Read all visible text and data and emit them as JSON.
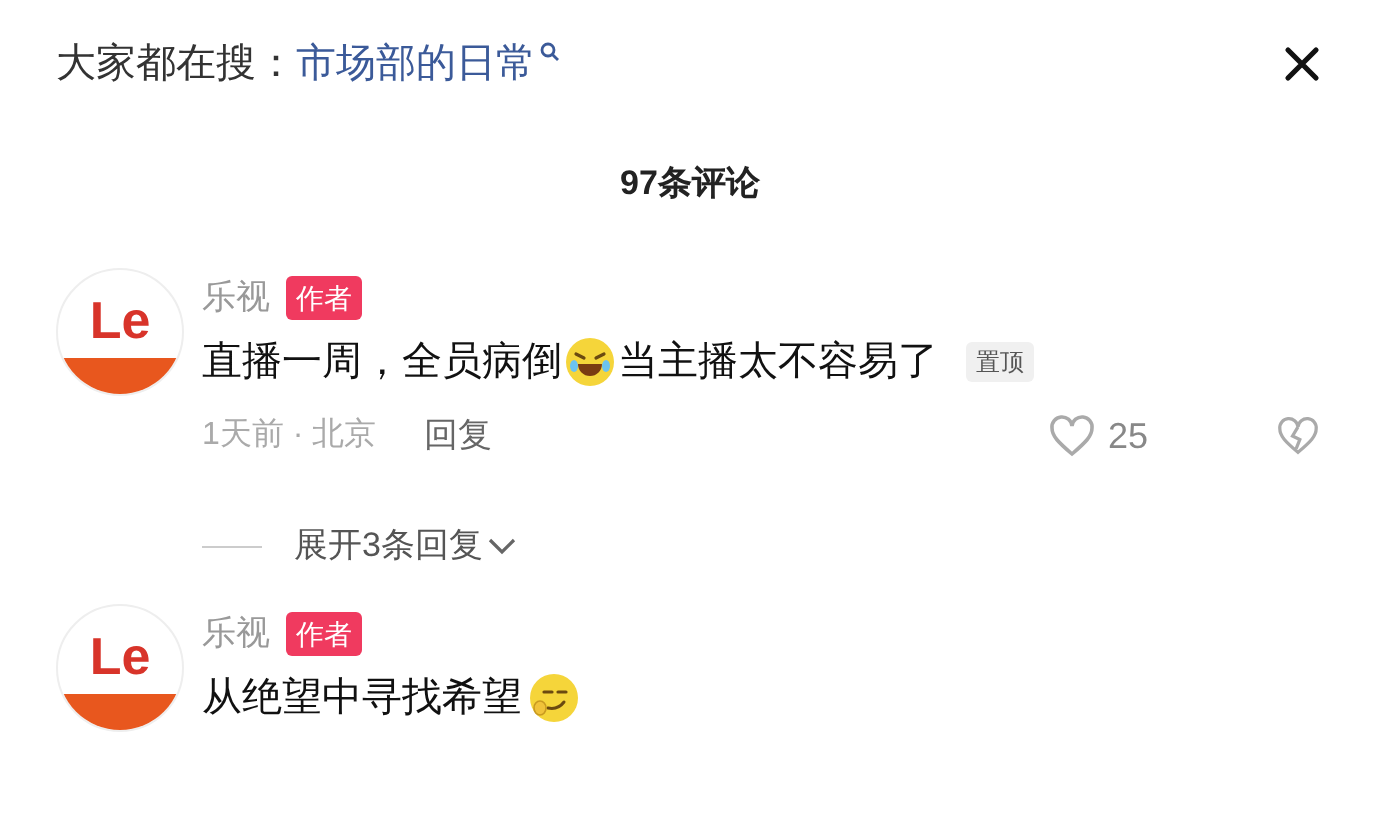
{
  "search_bar": {
    "label": "大家都在搜：",
    "query": "市场部的日常"
  },
  "comment_count": "97条评论",
  "comments": [
    {
      "avatar_text": "Le",
      "author": "乐视",
      "badge": "作者",
      "segments": [
        {
          "kind": "text",
          "text": "直播一周，全员病倒"
        },
        {
          "kind": "laughing"
        },
        {
          "kind": "text",
          "text": "当主播太不容易了"
        }
      ],
      "pinned_label": "置顶",
      "meta": "1天前 · 北京",
      "reply": "回复",
      "likes": "25",
      "replies_toggle": "展开3条回复"
    },
    {
      "avatar_text": "Le",
      "author": "乐视",
      "badge": "作者",
      "segments": [
        {
          "kind": "text",
          "text": "从绝望中寻找希望"
        },
        {
          "kind": "smirking"
        }
      ]
    }
  ]
}
